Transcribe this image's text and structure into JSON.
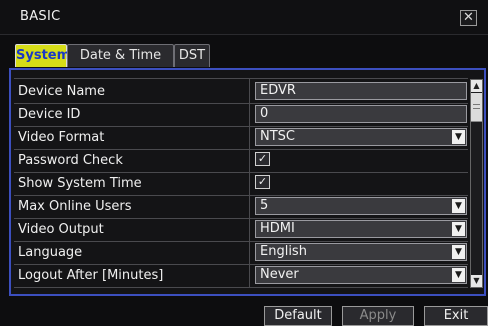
{
  "window": {
    "title": "BASIC",
    "close_icon": "close-icon"
  },
  "tabs": [
    {
      "label": "System",
      "active": true
    },
    {
      "label": "Date & Time",
      "active": false
    },
    {
      "label": "DST",
      "active": false
    }
  ],
  "settings": {
    "device_name": {
      "label": "Device Name",
      "value": "EDVR"
    },
    "device_id": {
      "label": "Device ID",
      "value": "0"
    },
    "video_format": {
      "label": "Video Format",
      "value": "NTSC"
    },
    "password_check": {
      "label": "Password Check",
      "checked": true
    },
    "show_system_time": {
      "label": "Show System Time",
      "checked": true
    },
    "max_online_users": {
      "label": "Max Online Users",
      "value": "5"
    },
    "video_output": {
      "label": "Video Output",
      "value": "HDMI"
    },
    "language": {
      "label": "Language",
      "value": "English"
    },
    "logout_after": {
      "label": "Logout After [Minutes]",
      "value": "Never"
    }
  },
  "buttons": {
    "default": "Default",
    "apply": "Apply",
    "exit": "Exit"
  },
  "colors": {
    "active_tab_bg": "#d6dd18",
    "active_tab_text": "#1a39c6",
    "panel_border": "#3c4fbf",
    "background": "#0d0d0f"
  }
}
